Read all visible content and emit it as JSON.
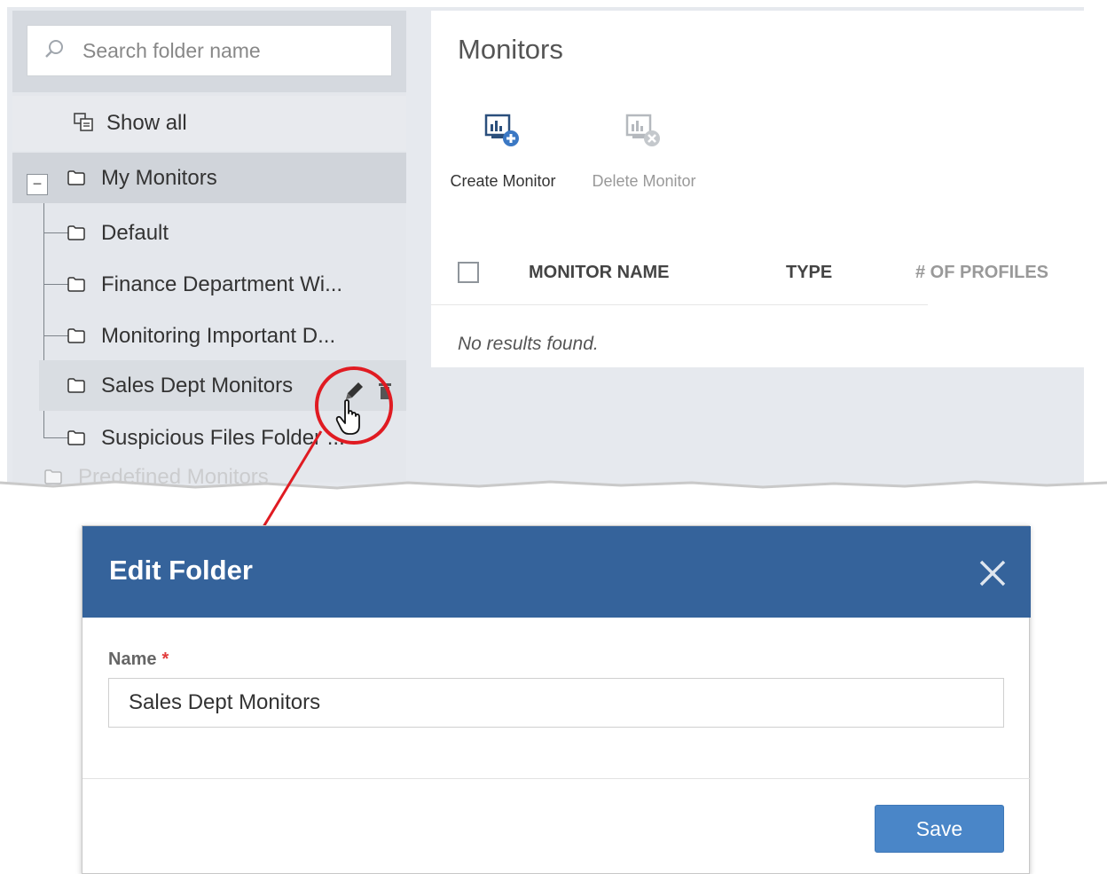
{
  "sidebar": {
    "search_placeholder": "Search folder name",
    "show_all_label": "Show all",
    "expander_symbol": "−",
    "tree": {
      "root_label": "My Monitors",
      "children": [
        "Default",
        "Finance Department Wi...",
        "Monitoring Important D...",
        "Sales Dept Monitors",
        "Suspicious Files Folder ..."
      ],
      "next_root_label": "Predefined Monitors"
    }
  },
  "main": {
    "title": "Monitors",
    "toolbar": {
      "create_label": "Create Monitor",
      "delete_label": "Delete Monitor"
    },
    "table": {
      "columns": [
        "MONITOR NAME",
        "TYPE",
        "# OF PROFILES"
      ],
      "empty_message": "No results found."
    }
  },
  "dialog": {
    "title": "Edit Folder",
    "name_label": "Name",
    "required_marker": "*",
    "name_value": "Sales Dept Monitors",
    "save_label": "Save"
  },
  "colors": {
    "header_blue": "#35639b",
    "save_blue": "#4a86c8",
    "highlight_red": "#e01b22"
  },
  "icons": {
    "search": "search-icon",
    "show_all": "show-all-icon",
    "folder": "folder-icon",
    "edit": "pencil-icon",
    "delete": "trash-icon",
    "cursor": "hand-cursor-icon",
    "create_monitor": "create-monitor-icon",
    "delete_monitor": "delete-monitor-icon",
    "close": "close-icon"
  }
}
